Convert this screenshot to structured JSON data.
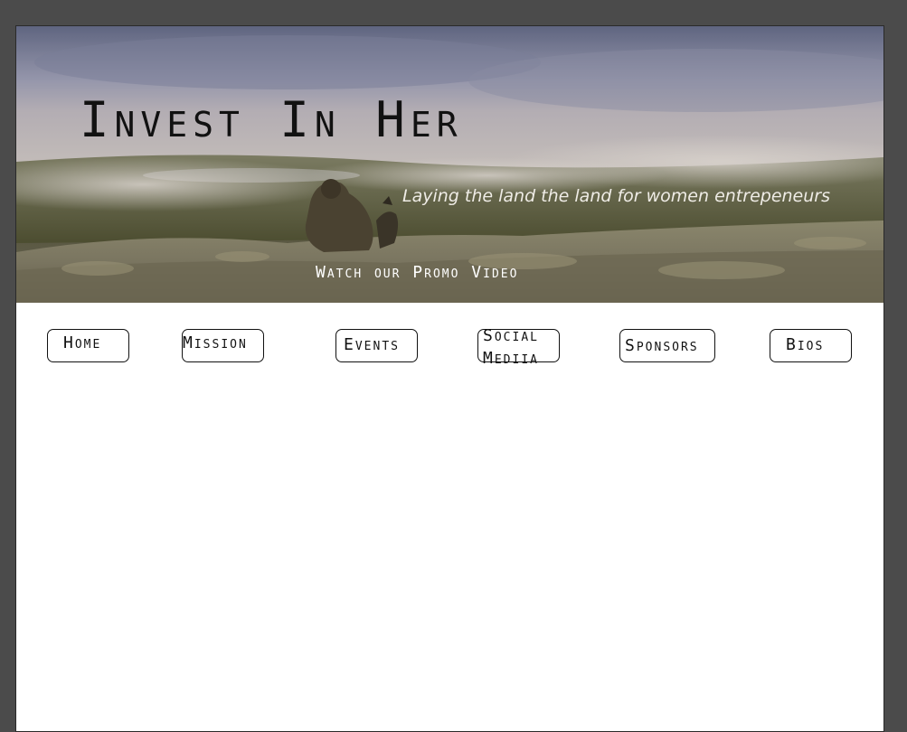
{
  "hero": {
    "title": "Invest In Her",
    "subtitle": "Laying the land the land for women entrepeneurs",
    "promo_link": "Watch our Promo Video"
  },
  "nav": {
    "home": "Home",
    "mission": "Mission",
    "events": "Events",
    "social_media": "Social Mediia",
    "sponsors": "Sponsors",
    "bios": "Bios"
  }
}
